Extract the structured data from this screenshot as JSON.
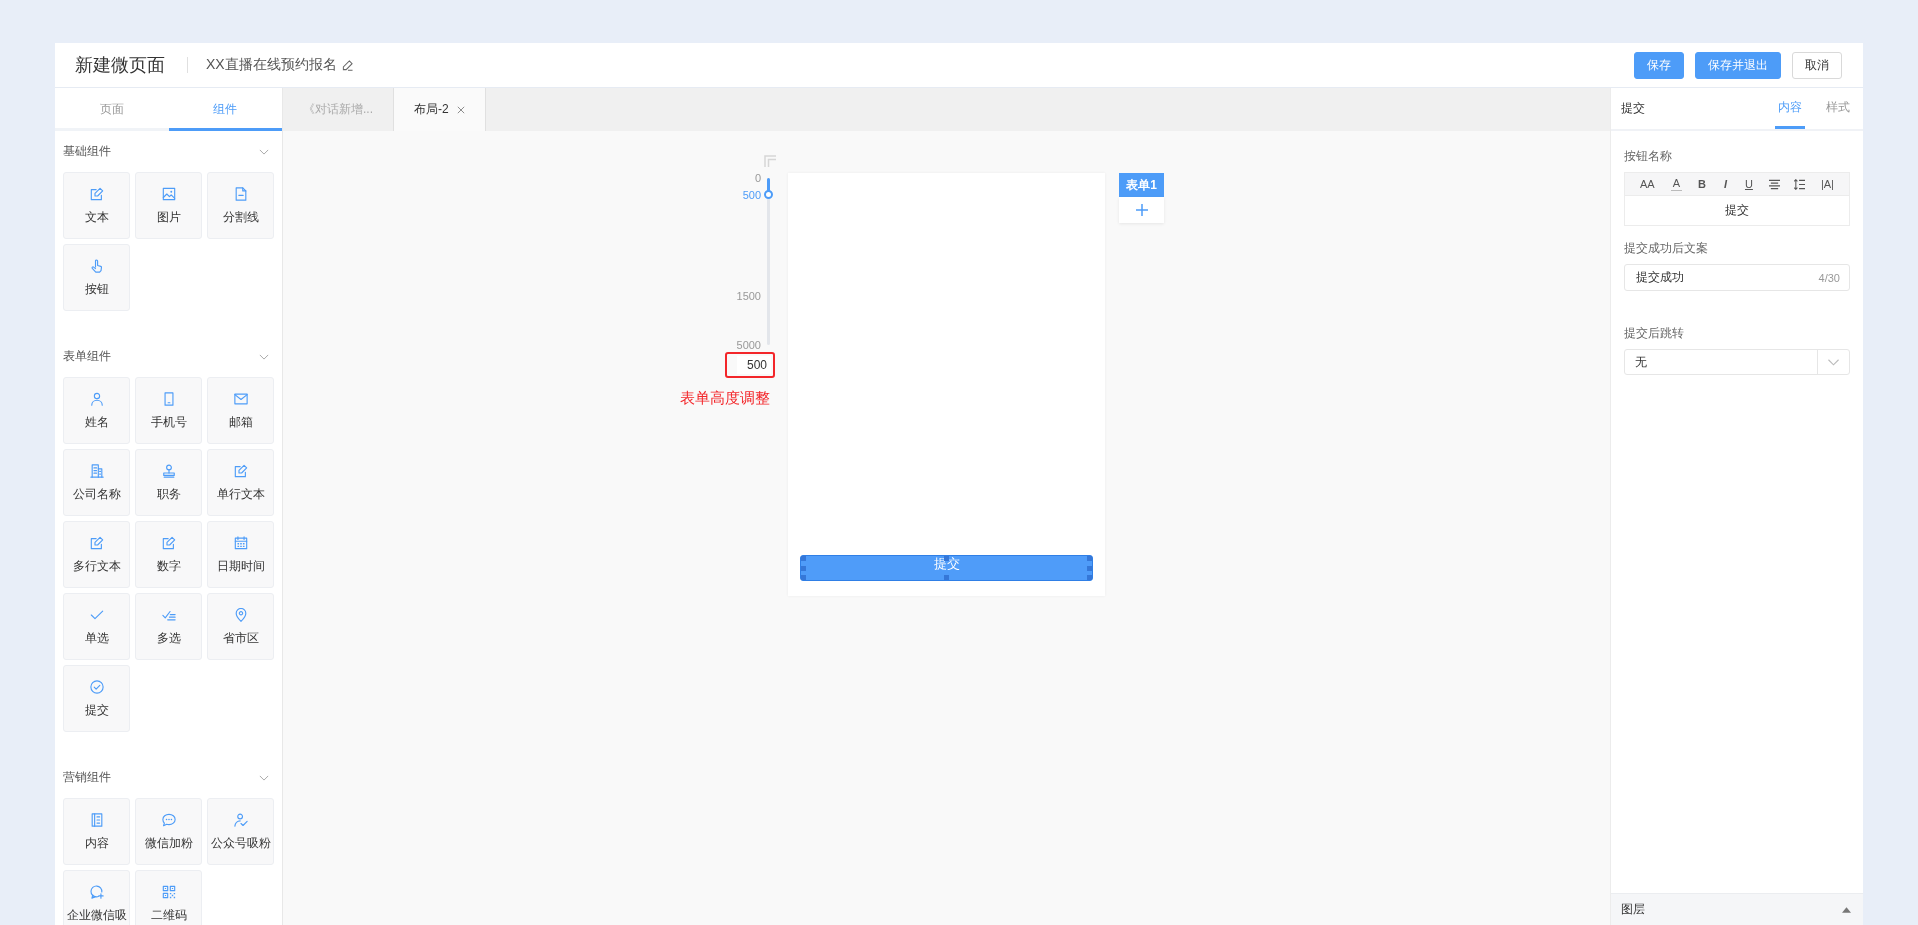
{
  "header": {
    "title": "新建微页面",
    "page_name": "XX直播在线预约报名",
    "buttons": [
      {
        "label": "保存",
        "kind": "primary"
      },
      {
        "label": "保存并退出",
        "kind": "primary"
      },
      {
        "label": "取消",
        "kind": "default"
      }
    ]
  },
  "sidebar": {
    "tabs": [
      {
        "label": "页面",
        "selected": false
      },
      {
        "label": "组件",
        "selected": true
      }
    ],
    "groups": [
      {
        "title": "基础组件",
        "expanded": true,
        "items": [
          {
            "label": "文本",
            "kind": "text"
          },
          {
            "label": "图片",
            "kind": "image"
          },
          {
            "label": "分割线",
            "kind": "divider"
          },
          {
            "label": "按钮",
            "kind": "button"
          }
        ]
      },
      {
        "title": "表单组件",
        "expanded": true,
        "items": [
          {
            "label": "姓名",
            "kind": "name"
          },
          {
            "label": "手机号",
            "kind": "mobile"
          },
          {
            "label": "邮箱",
            "kind": "email"
          },
          {
            "label": "公司名称",
            "kind": "company"
          },
          {
            "label": "职务",
            "kind": "position"
          },
          {
            "label": "单行文本",
            "kind": "singleline"
          },
          {
            "label": "多行文本",
            "kind": "multiline"
          },
          {
            "label": "数字",
            "kind": "number"
          },
          {
            "label": "日期时间",
            "kind": "datetime"
          },
          {
            "label": "单选",
            "kind": "radio"
          },
          {
            "label": "多选",
            "kind": "multiselect"
          },
          {
            "label": "省市区",
            "kind": "region"
          },
          {
            "label": "提交",
            "kind": "submit"
          }
        ]
      },
      {
        "title": "营销组件",
        "expanded": true,
        "items": [
          {
            "label": "内容",
            "kind": "content"
          },
          {
            "label": "微信加粉",
            "kind": "wechat"
          },
          {
            "label": "公众号吸粉",
            "kind": "official"
          },
          {
            "label": "企业微信吸",
            "kind": "enterprise"
          },
          {
            "label": "二维码",
            "kind": "qrcode"
          }
        ]
      }
    ]
  },
  "editor_tabs": [
    {
      "label": "《对话新增...",
      "selected": false,
      "closable": false
    },
    {
      "label": "布局-2",
      "selected": true,
      "closable": true
    }
  ],
  "canvas": {
    "height_ruler": {
      "marks": [
        {
          "label": "0",
          "selected": false
        },
        {
          "label": "500",
          "selected": true
        },
        {
          "label": "1500",
          "selected": false
        },
        {
          "label": "5000",
          "selected": false
        }
      ],
      "level": 0.1,
      "value": "500",
      "annotation": "表单高度调整"
    },
    "form": {
      "submit_label": "提交",
      "selected": true
    },
    "form_tabs": [
      {
        "label": "表单1",
        "selected": true
      }
    ]
  },
  "properties": {
    "title": "提交",
    "tabs": [
      {
        "label": "内容",
        "selected": true
      },
      {
        "label": "样式",
        "selected": false
      }
    ],
    "fields": [
      {
        "kind": "richtext",
        "label": "按钮名称",
        "tools": [
          {
            "kind": "fontsize",
            "label": "AA"
          },
          {
            "kind": "color",
            "label": "A"
          },
          {
            "kind": "bold",
            "label": "B"
          },
          {
            "kind": "italic",
            "label": "I"
          },
          {
            "kind": "underline",
            "label": "U"
          },
          {
            "kind": "align"
          },
          {
            "kind": "lineheight"
          },
          {
            "kind": "spacing",
            "label": "|A|"
          }
        ],
        "value": "提交"
      },
      {
        "kind": "text",
        "label": "提交成功后文案",
        "value": "提交成功",
        "counter": "4/30"
      },
      {
        "kind": "select",
        "label": "提交后跳转",
        "value": "无"
      }
    ]
  },
  "layers_panel": {
    "title": "图层",
    "expanded": false
  }
}
